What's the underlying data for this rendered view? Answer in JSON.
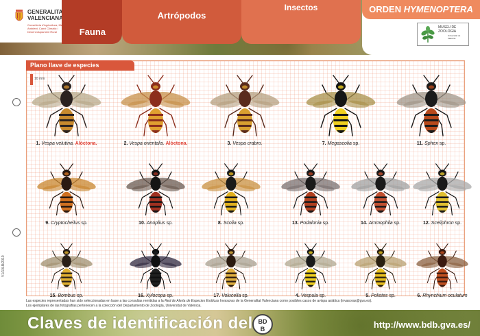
{
  "header": {
    "gv_name_line1": "GENERALITAT",
    "gv_name_line2": "VALENCIANA",
    "gv_dept": "Conselleria d'Agricultura, Medi Ambient, Canvi Climàtic i Desenvolupament Rural",
    "tabs": [
      {
        "label": "Fauna"
      },
      {
        "label": "Artrópodos"
      },
      {
        "label": "Insectos"
      }
    ],
    "orden_prefix": "ORDEN",
    "orden_name": "HYMENOPTERA",
    "museum_name": "MUSEU DE ZOOLOGIA",
    "museum_sub": "Universitat de València"
  },
  "panel": {
    "label": "Plano llave de especies",
    "scale": "10 mm"
  },
  "version": "V1/10LB/2019",
  "species": [
    {
      "num": "1.",
      "name": "Vespa velutina.",
      "suffix": " Alóctona.",
      "alien": true,
      "color": "#2b2220",
      "accent": "#c88a2e",
      "wings": "#b8a98a"
    },
    {
      "num": "2.",
      "name": "Vespa orientalis.",
      "suffix": " Alóctona.",
      "alien": true,
      "color": "#8c2e1c",
      "accent": "#e0a030",
      "wings": "#c7904a"
    },
    {
      "num": "3.",
      "name": "Vespa crabro.",
      "suffix": "",
      "alien": false,
      "color": "#5a2a1c",
      "accent": "#d9a030",
      "wings": "#b5a080"
    },
    {
      "num": "7.",
      "name": "Megascolia",
      "suffix": " sp.",
      "alien": false,
      "color": "#151515",
      "accent": "#f0d020",
      "wings": "#a8904a"
    },
    {
      "num": "11.",
      "name": "Sphex",
      "suffix": " sp.",
      "alien": false,
      "color": "#1b1b1b",
      "accent": "#b84a1c",
      "wings": "#a09688"
    },
    {
      "num": "9.",
      "name": "Cryptocheilus",
      "suffix": " sp.",
      "alien": false,
      "color": "#2a1a12",
      "accent": "#d07020",
      "wings": "#c8862e"
    },
    {
      "num": "10.",
      "name": "Anoplius",
      "suffix": " sp.",
      "alien": false,
      "color": "#151515",
      "accent": "#a03020",
      "wings": "#6a5a50"
    },
    {
      "num": "8.",
      "name": "Scolia",
      "suffix": " sp.",
      "alien": false,
      "color": "#1a1a1a",
      "accent": "#e0b020",
      "wings": "#c89040"
    },
    {
      "num": "13.",
      "name": "Podalonia",
      "suffix": " sp.",
      "alien": false,
      "color": "#1a1a1a",
      "accent": "#b04020",
      "wings": "#7a7070"
    },
    {
      "num": "14.",
      "name": "Ammophila",
      "suffix": " sp.",
      "alien": false,
      "color": "#1a1a1a",
      "accent": "#c05030",
      "wings": "#a0a0a0"
    },
    {
      "num": "12.",
      "name": "Sceliphron",
      "suffix": " sp.",
      "alien": false,
      "color": "#1a1a1a",
      "accent": "#e0c030",
      "wings": "#a8a8a8"
    },
    {
      "num": "15.",
      "name": "Bombus",
      "suffix": " sp.",
      "alien": false,
      "color": "#2a2018",
      "accent": "#e0b030",
      "wings": "#a09070"
    },
    {
      "num": "16.",
      "name": "Xylocopa",
      "suffix": " sp.",
      "alien": false,
      "color": "#101010",
      "accent": "#202020",
      "wings": "#302a40"
    },
    {
      "num": "17.",
      "name": "Volucella",
      "suffix": " sp.",
      "alien": false,
      "color": "#2a1a10",
      "accent": "#e0b040",
      "wings": "#a8a090"
    },
    {
      "num": "4.",
      "name": "Vespula",
      "suffix": " sp.",
      "alien": false,
      "color": "#1a1a1a",
      "accent": "#f0d020",
      "wings": "#b0a890"
    },
    {
      "num": "5.",
      "name": "Polistes",
      "suffix": " sp.",
      "alien": false,
      "color": "#2a2010",
      "accent": "#e8c020",
      "wings": "#b8a070"
    },
    {
      "num": "6.",
      "name": "Rhynchium oculatum",
      "suffix": "",
      "alien": false,
      "color": "#3a1a10",
      "accent": "#c05020",
      "wings": "#8a6040"
    }
  ],
  "notes": {
    "line1_pre": "Las especies representadas han sido seleccionadas en base a las consultas remitidas a la",
    "line1_italic": "Red de Alerta de Especies Exóticas Invasoras",
    "line1_post": "de la Generalitat Valenciana como posibles casos de avispa asiática (invasoras@gva.es).",
    "line2": "Los ejemplares de las fotografías pertenecen a la colección del Departamento de Zoología, Universitat de València."
  },
  "footer": {
    "title": "Claves de identificación del",
    "bdb_line1": "BD",
    "bdb_line2": "B",
    "url": "http://www.bdb.gva.es/"
  }
}
